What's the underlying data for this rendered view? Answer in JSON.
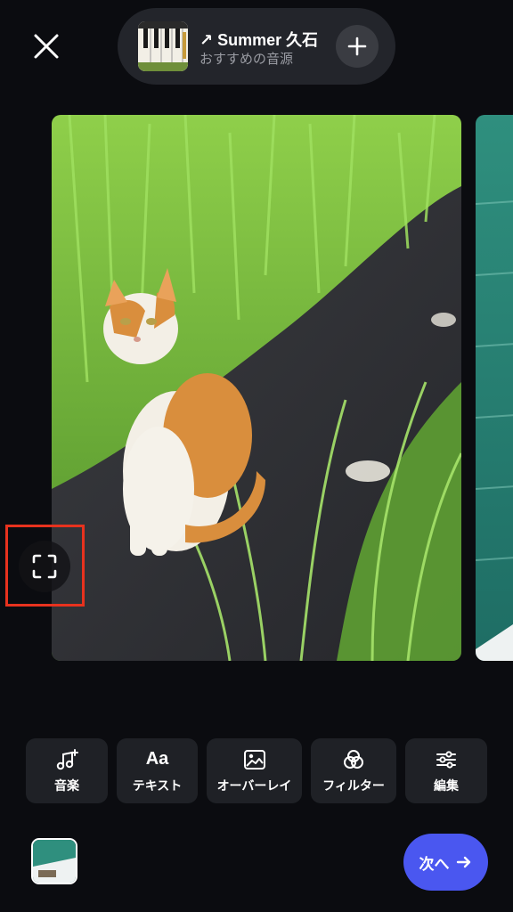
{
  "header": {
    "close_icon": "close-icon",
    "music": {
      "title": "↗ Summer 久石",
      "subtitle": "おすすめの音源",
      "add_icon": "plus-icon"
    }
  },
  "editor": {
    "fullscreen_icon": "fullscreen-icon",
    "highlight_color": "#e8321e"
  },
  "toolbar": {
    "items": [
      {
        "label": "音楽",
        "icon": "music-note-plus-icon"
      },
      {
        "label": "テキスト",
        "icon": "text-aa-icon"
      },
      {
        "label": "オーバーレイ",
        "icon": "image-icon"
      },
      {
        "label": "フィルター",
        "icon": "filter-circles-icon"
      },
      {
        "label": "編集",
        "icon": "sliders-icon"
      }
    ]
  },
  "footer": {
    "next_label": "次へ",
    "next_color": "#4a57f0"
  }
}
